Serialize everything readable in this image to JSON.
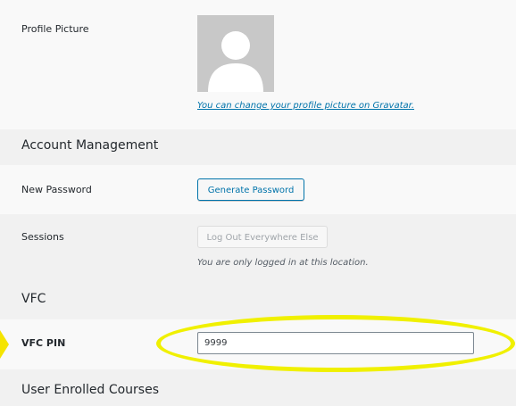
{
  "profile_picture": {
    "label": "Profile Picture",
    "gravatar_link": "You can change your profile picture on Gravatar."
  },
  "account_management": {
    "heading": "Account Management",
    "new_password_label": "New Password",
    "generate_password_button": "Generate Password",
    "sessions_label": "Sessions",
    "logout_everywhere_button": "Log Out Everywhere Else",
    "sessions_hint": "You are only logged in at this location."
  },
  "vfc": {
    "heading": "VFC",
    "pin_label": "VFC PIN",
    "pin_value": "9999"
  },
  "user_enrolled_courses": {
    "heading": "User Enrolled Courses"
  },
  "colors": {
    "link": "#0073aa",
    "highlight": "#f0f000",
    "background": "#f1f1f1"
  }
}
